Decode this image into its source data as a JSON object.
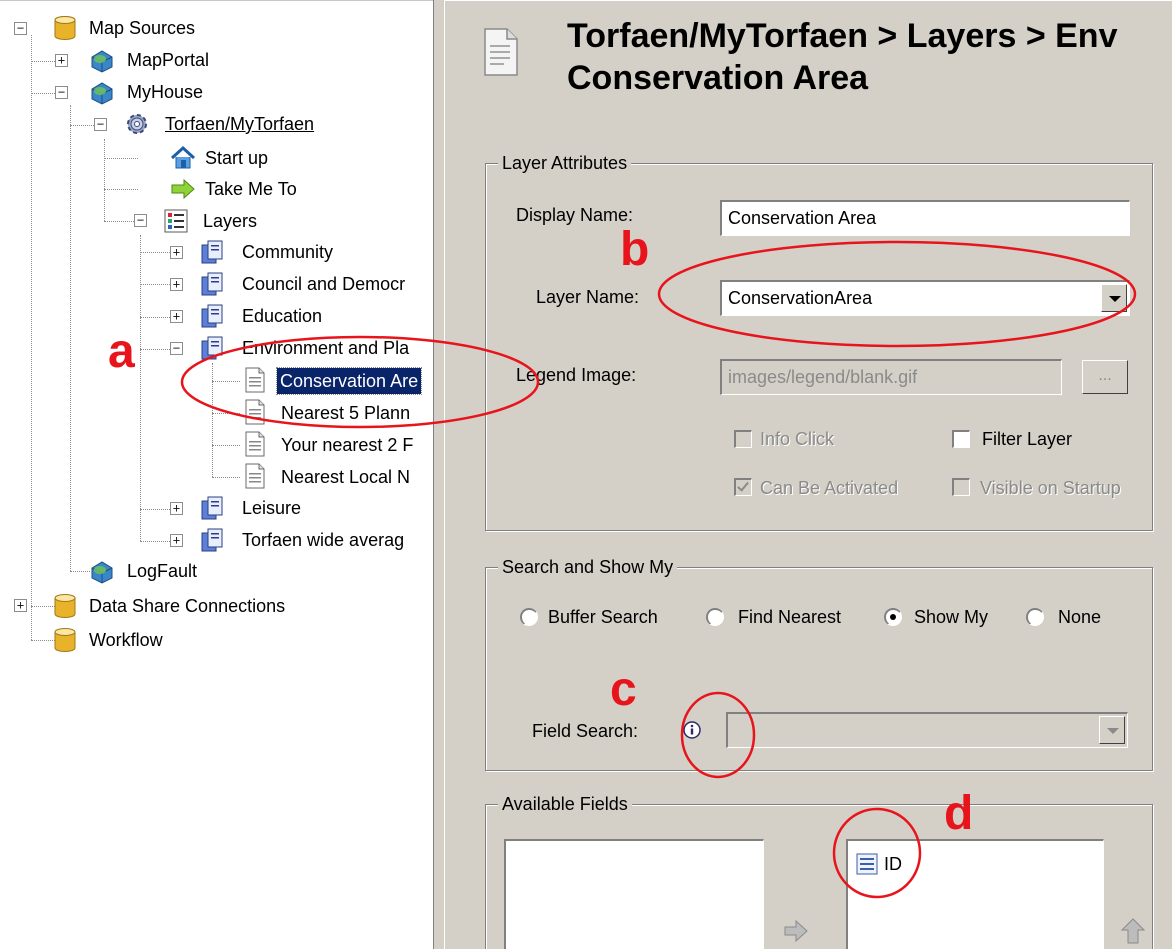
{
  "tree": {
    "map_sources": "Map Sources",
    "map_portal": "MapPortal",
    "my_house": "MyHouse",
    "torfaen": "Torfaen/MyTorfaen",
    "start_up": "Start up",
    "take_me_to": "Take Me To",
    "layers": "Layers",
    "community": "Community",
    "council": "Council and Democr",
    "education": "Education",
    "environment": "Environment and Pla",
    "conservation": "Conservation Are",
    "nearest5": "Nearest 5 Plann",
    "your_nearest2": "Your nearest 2 F",
    "nearest_local": "Nearest Local N",
    "leisure": "Leisure",
    "torfaen_wide": "Torfaen wide averag",
    "log_fault": "LogFault",
    "data_share": "Data Share Connections",
    "workflow": "Workflow"
  },
  "header": {
    "title": "Torfaen/MyTorfaen > Layers > Env\nConservation Area"
  },
  "layer_attributes": {
    "group_title": "Layer Attributes",
    "display_name_label": "Display Name:",
    "display_name_value": "Conservation Area",
    "layer_name_label": "Layer Name:",
    "layer_name_value": "ConservationArea",
    "legend_image_label": "Legend Image:",
    "legend_image_value": "images/legend/blank.gif",
    "browse_label": "...",
    "info_click_label": "Info Click",
    "filter_layer_label": "Filter Layer",
    "can_be_activated_label": "Can Be Activated",
    "visible_on_startup_label": "Visible on Startup"
  },
  "search_show": {
    "group_title": "Search and Show My",
    "buffer_search": "Buffer Search",
    "find_nearest": "Find Nearest",
    "show_my": "Show My",
    "none": "None",
    "selected": "Show My",
    "field_search_label": "Field Search:",
    "field_search_value": ""
  },
  "available_fields": {
    "group_title": "Available Fields",
    "selected_fields": [
      "ID"
    ]
  },
  "annotations": {
    "a": "a",
    "b": "b",
    "c": "c",
    "d": "d",
    "color": "#e8141c"
  },
  "icons": {
    "database": "database-icon",
    "globe": "globe-icon",
    "gear": "gear-icon",
    "home": "home-icon",
    "arrow": "arrow-right-icon",
    "layers": "layers-list-icon",
    "folder_layer": "layer-group-icon",
    "document": "document-icon",
    "info": "info-icon"
  }
}
